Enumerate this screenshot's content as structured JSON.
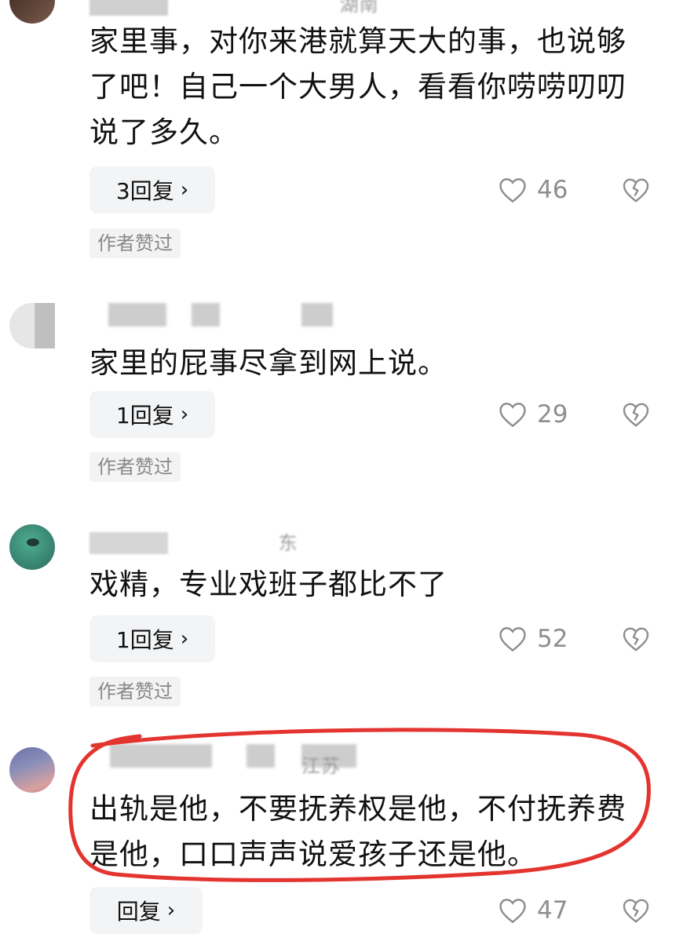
{
  "comments": [
    {
      "meta": "湖南",
      "text": "家里事，对你来港就算天大的事，也说够了吧！自己一个大男人，看看你唠唠叨叨说了多久。",
      "reply_label": "3回复",
      "likes": "46",
      "author_liked": "作者赞过"
    },
    {
      "meta": "",
      "text": "家里的屁事尽拿到网上说。",
      "reply_label": "1回复",
      "likes": "29",
      "author_liked": "作者赞过"
    },
    {
      "meta": "东",
      "text": "戏精，专业戏班子都比不了",
      "reply_label": "1回复",
      "likes": "52",
      "author_liked": "作者赞过"
    },
    {
      "meta": "江苏",
      "text": "出轨是他，不要抚养权是他，不付抚养费是他，口口声声说爱孩子还是他。",
      "reply_label": "回复",
      "likes": "47",
      "author_liked": ""
    }
  ],
  "icons": {
    "like": "heart-outline-icon",
    "dislike": "broken-heart-icon",
    "reply_chevron": "chevron-right-icon"
  },
  "colors": {
    "highlight_ring": "#e3342f",
    "muted_text": "#8e8e8e",
    "button_bg": "#f3f4f6"
  }
}
